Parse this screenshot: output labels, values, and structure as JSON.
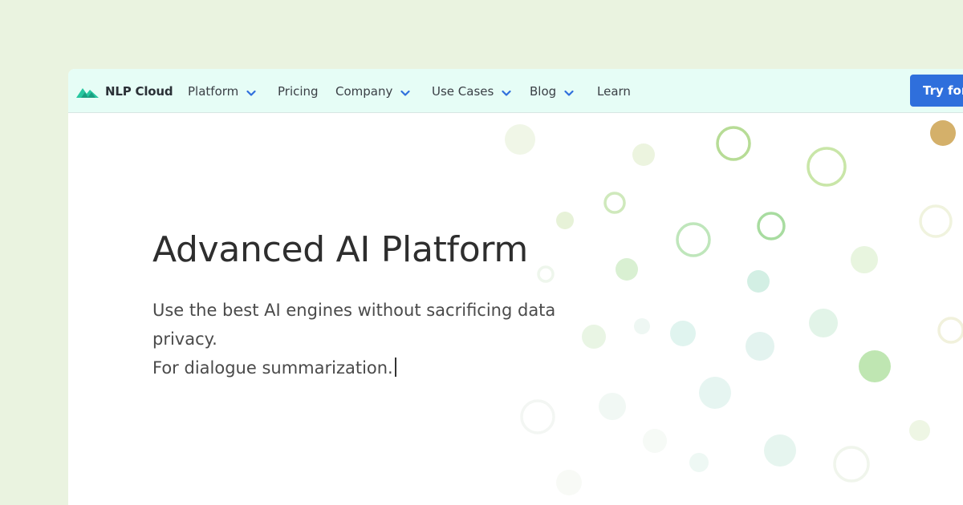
{
  "colors": {
    "page_bg": "#eaf3e0",
    "nav_bg": "#e6fdf6",
    "brand_teal": "#27c7a0",
    "cta_blue": "#2f6fdc",
    "chevron_blue": "#2f6fdc"
  },
  "brand": {
    "name": "NLP Cloud",
    "icon": "mountain-logo-icon"
  },
  "nav": {
    "items": [
      {
        "label": "Platform",
        "dropdown": true
      },
      {
        "label": "Pricing",
        "dropdown": false
      },
      {
        "label": "Company",
        "dropdown": true
      },
      {
        "label": "Use Cases",
        "dropdown": true
      },
      {
        "label": "Blog",
        "dropdown": true
      },
      {
        "label": "Learn",
        "dropdown": false
      }
    ],
    "cta_label": "Try for"
  },
  "hero": {
    "title": "Advanced AI Platform",
    "subtitle_line1": "Use the best AI engines without sacrificing data privacy.",
    "subtitle_line2": "For dialogue summarization."
  }
}
